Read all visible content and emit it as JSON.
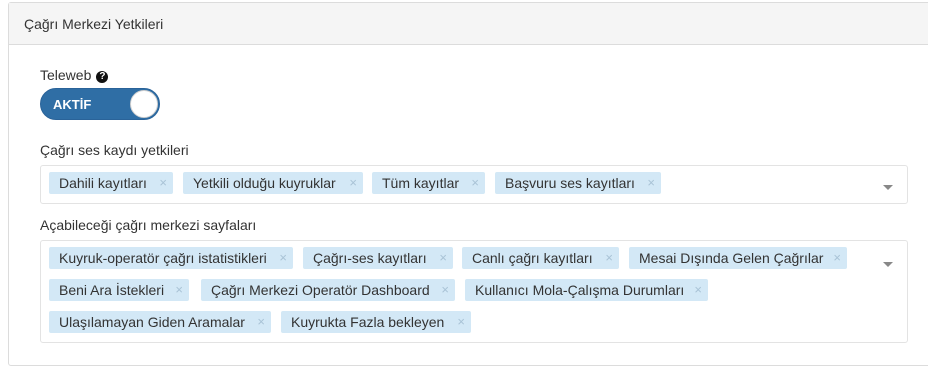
{
  "panel": {
    "title": "Çağrı Merkezi Yetkileri"
  },
  "teleweb": {
    "label": "Teleweb",
    "help_icon": "?",
    "toggle_label": "AKTİF",
    "toggle_on": true
  },
  "recording_permissions": {
    "label": "Çağrı ses kaydı yetkileri",
    "tags": [
      "Dahili kayıtları",
      "Yetkili olduğu kuyruklar",
      "Tüm kayıtlar",
      "Başvuru ses kayıtları"
    ]
  },
  "call_center_pages": {
    "label": "Açabileceği çağrı merkezi sayfaları",
    "tags": [
      "Kuyruk-operatör çağrı istatistikleri",
      "Çağrı-ses kayıtları",
      "Canlı çağrı kayıtları",
      "Mesai Dışında Gelen Çağrılar",
      "Beni Ara İstekleri",
      "Çağrı Merkezi Operatör Dashboard",
      "Kullanıcı Mola-Çalışma Durumları",
      "Ulaşılamayan Giden Aramalar",
      "Kuyrukta Fazla bekleyen"
    ]
  },
  "tag_remove_symbol": "×",
  "colors": {
    "toggle_bg": "#2f6ea5",
    "tag_bg": "#d3e8f6",
    "panel_heading_bg": "#f5f5f5"
  }
}
